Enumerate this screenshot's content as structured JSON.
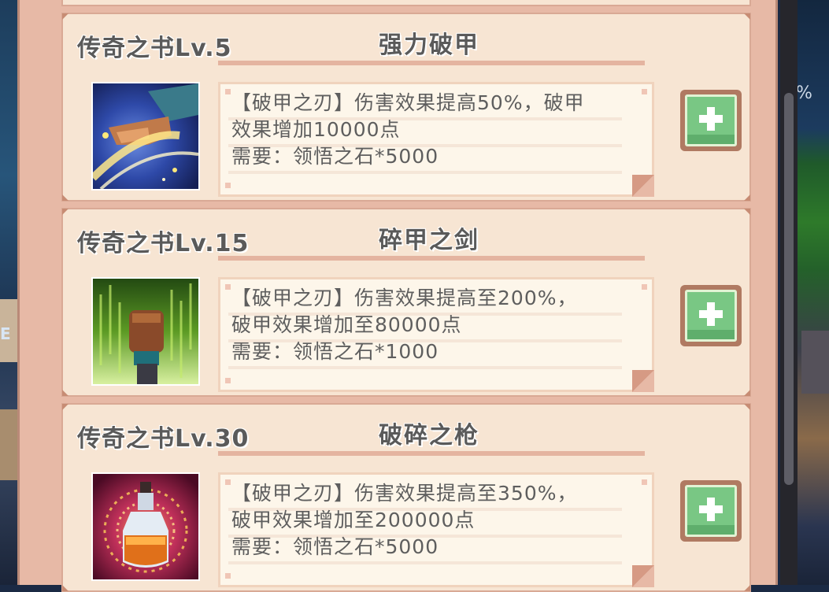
{
  "background": {
    "left_tag": "E",
    "right_percent": "%"
  },
  "talents": [
    {
      "level_label": "传奇之书Lv.5",
      "skill_name": "强力破甲",
      "icon": "golden-hand-strike-icon",
      "desc_lines": [
        "【破甲之刃】伤害效果提高50%，破甲",
        "效果增加10000点",
        "需要：领悟之石*5000"
      ],
      "button": "plus-icon"
    },
    {
      "level_label": "传奇之书Lv.15",
      "skill_name": "碎甲之剑",
      "icon": "green-fist-icon",
      "desc_lines": [
        "【破甲之刃】伤害效果提高至200%，",
        "破甲效果增加至80000点",
        "需要：领悟之石*1000"
      ],
      "button": "plus-icon"
    },
    {
      "level_label": "传奇之书Lv.30",
      "skill_name": "破碎之枪",
      "icon": "potion-bottle-icon",
      "desc_lines": [
        "【破甲之刃】伤害效果提高至350%，",
        "破甲效果增加至200000点",
        "需要：领悟之石*5000"
      ],
      "button": "plus-icon"
    }
  ],
  "colors": {
    "panel": "#e7b9a6",
    "card": "#f7e5d3",
    "text": "#5a5a5a",
    "button_green": "#79c784"
  }
}
